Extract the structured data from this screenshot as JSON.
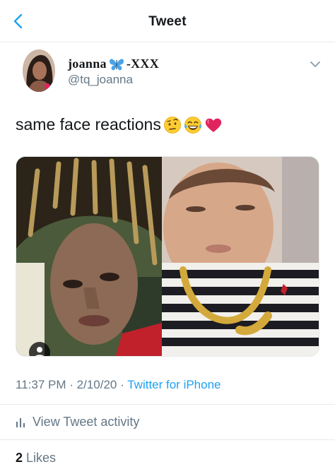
{
  "header": {
    "title": "Tweet",
    "back_icon": "chevron-left-icon"
  },
  "author": {
    "display_name": "joanna",
    "display_suffix": "-XXX",
    "handle": "@tq_joanna",
    "name_emoji": "blue-butterfly-icon",
    "menu_icon": "chevron-down-icon"
  },
  "tweet": {
    "text": "same face reactions",
    "emojis": [
      "face-with-raised-eyebrow",
      "face-with-tears-of-joy",
      "red-heart"
    ]
  },
  "media": {
    "left_image": "photo-man-with-dreadlocks",
    "right_image": "photo-baby-with-gold-chain",
    "alt_icon": "person-icon"
  },
  "meta": {
    "time": "11:37 PM",
    "separator": "·",
    "date": "2/10/20",
    "separator2": "·",
    "source": "Twitter for iPhone"
  },
  "activity": {
    "label": "View Tweet activity",
    "icon": "bar-chart-icon"
  },
  "likes": {
    "count": "2",
    "label": "Likes"
  },
  "colors": {
    "accent": "#1da1f2",
    "secondary_text": "#657786",
    "primary_text": "#14171a",
    "divider": "#e6ecf0"
  }
}
